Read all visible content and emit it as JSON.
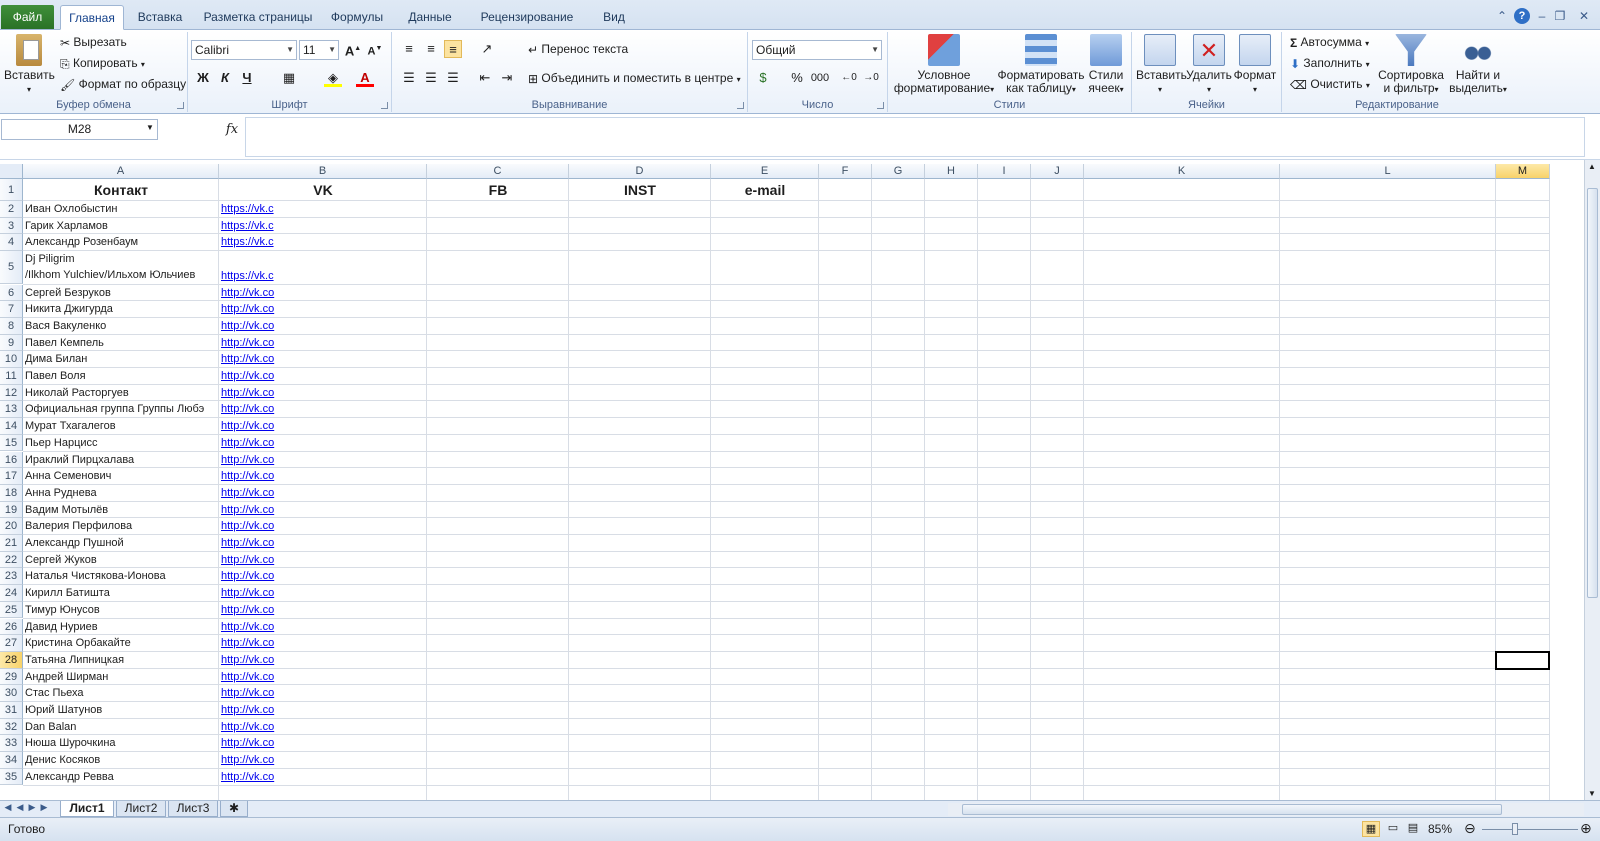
{
  "tabs": {
    "file": "Файл",
    "items": [
      "Главная",
      "Вставка",
      "Разметка страницы",
      "Формулы",
      "Данные",
      "Рецензирование",
      "Вид"
    ]
  },
  "ribbon": {
    "clipboard": {
      "label": "Буфер обмена",
      "paste": "Вставить",
      "cut": "Вырезать",
      "copy": "Копировать",
      "format_painter": "Формат по образцу"
    },
    "font": {
      "label": "Шрифт",
      "name": "Calibri",
      "size": "11",
      "bold": "Ж",
      "italic": "К",
      "underline": "Ч"
    },
    "alignment": {
      "label": "Выравнивание",
      "wrap": "Перенос текста",
      "merge": "Объединить и поместить в центре"
    },
    "number": {
      "label": "Число",
      "format": "Общий",
      "percent": "%",
      "thousands": "000"
    },
    "styles": {
      "label": "Стили",
      "conditional": [
        "Условное",
        "форматирование"
      ],
      "as_table": [
        "Форматировать",
        "как таблицу"
      ],
      "cell_styles": [
        "Стили",
        "ячеек"
      ]
    },
    "cells": {
      "label": "Ячейки",
      "insert": "Вставить",
      "delete": "Удалить",
      "format": "Формат"
    },
    "editing": {
      "label": "Редактирование",
      "autosum": "Автосумма",
      "fill": "Заполнить",
      "clear": "Очистить",
      "sort": [
        "Сортировка",
        "и фильтр"
      ],
      "find": [
        "Найти и",
        "выделить"
      ]
    }
  },
  "formula_bar": {
    "name_box": "M28",
    "fx": "fx",
    "value": ""
  },
  "grid": {
    "columns": [
      "A",
      "B",
      "C",
      "D",
      "E",
      "F",
      "G",
      "H",
      "I",
      "J",
      "K",
      "L",
      "M"
    ],
    "headers": {
      "A": "Контакт",
      "B": "VK",
      "C": "FB",
      "D": "INST",
      "E": "e-mail"
    },
    "rows": [
      {
        "n": "2",
        "contact": "Иван Охлобыстин",
        "vk": "https://vk.c"
      },
      {
        "n": "3",
        "contact": "Гарик Харламов",
        "vk": "https://vk.c"
      },
      {
        "n": "4",
        "contact": "Александр Розенбаум",
        "vk": "https://vk.c"
      },
      {
        "n": "5",
        "contact": "Dj Piligrim",
        "contact2": "/Ilkhom Yulchiev/Ильхом Юльчиев",
        "vk": "https://vk.c"
      },
      {
        "n": "6",
        "contact": "Сергей Безруков",
        "vk": "http://vk.co"
      },
      {
        "n": "7",
        "contact": "Никита Джигурда",
        "vk": "http://vk.co"
      },
      {
        "n": "8",
        "contact": "Вася Вакуленко",
        "vk": "http://vk.co"
      },
      {
        "n": "9",
        "contact": "Павел Кемпель",
        "vk": "http://vk.co"
      },
      {
        "n": "10",
        "contact": "Дима Билан",
        "vk": "http://vk.co"
      },
      {
        "n": "11",
        "contact": "Павел Воля",
        "vk": "http://vk.co"
      },
      {
        "n": "12",
        "contact": "Николай Расторгуев",
        "vk": "http://vk.co"
      },
      {
        "n": "13",
        "contact": "Официальная группа Группы Любэ",
        "vk": "http://vk.co"
      },
      {
        "n": "14",
        "contact": "Мурат Тхагалегов",
        "vk": "http://vk.co"
      },
      {
        "n": "15",
        "contact": "Пьер Нарцисс",
        "vk": "http://vk.co"
      },
      {
        "n": "16",
        "contact": "Ираклий Пирцхалава",
        "vk": "http://vk.co"
      },
      {
        "n": "17",
        "contact": "Анна Семенович",
        "vk": "http://vk.co"
      },
      {
        "n": "18",
        "contact": "Анна Руднева",
        "vk": "http://vk.co"
      },
      {
        "n": "19",
        "contact": "Вадим Мотылёв",
        "vk": "http://vk.co"
      },
      {
        "n": "20",
        "contact": "Валерия Перфилова",
        "vk": "http://vk.co"
      },
      {
        "n": "21",
        "contact": "Александр Пушной",
        "vk": "http://vk.co"
      },
      {
        "n": "22",
        "contact": "Сергей Жуков",
        "vk": "http://vk.co"
      },
      {
        "n": "23",
        "contact": "Наталья Чистякова-Ионова",
        "vk": "http://vk.co"
      },
      {
        "n": "24",
        "contact": "Кирилл Батишта",
        "vk": "http://vk.co"
      },
      {
        "n": "25",
        "contact": "Тимур Юнусов",
        "vk": "http://vk.co"
      },
      {
        "n": "26",
        "contact": "Давид Нуриев",
        "vk": "http://vk.co"
      },
      {
        "n": "27",
        "contact": "Кристина Орбакайте",
        "vk": "http://vk.co"
      },
      {
        "n": "28",
        "contact": "Татьяна Липницкая",
        "vk": "http://vk.co"
      },
      {
        "n": "29",
        "contact": "Андрей Ширман",
        "vk": "http://vk.co"
      },
      {
        "n": "30",
        "contact": "Стас Пьеха",
        "vk": "http://vk.co"
      },
      {
        "n": "31",
        "contact": "Юрий Шатунов",
        "vk": "http://vk.co"
      },
      {
        "n": "32",
        "contact": "Dan Balan",
        "vk": "http://vk.co"
      },
      {
        "n": "33",
        "contact": "Нюша Шурочкина",
        "vk": "http://vk.co"
      },
      {
        "n": "34",
        "contact": "Денис Косяков",
        "vk": "http://vk.co"
      },
      {
        "n": "35",
        "contact": "Александр Ревва",
        "vk": "http://vk.co"
      }
    ]
  },
  "sheets": [
    "Лист1",
    "Лист2",
    "Лист3"
  ],
  "status": {
    "ready": "Готово",
    "zoom": "85%"
  },
  "colors": {
    "file_tab": "#2a7226",
    "link": "#0000ee",
    "selected_header": "#f8d26a"
  }
}
